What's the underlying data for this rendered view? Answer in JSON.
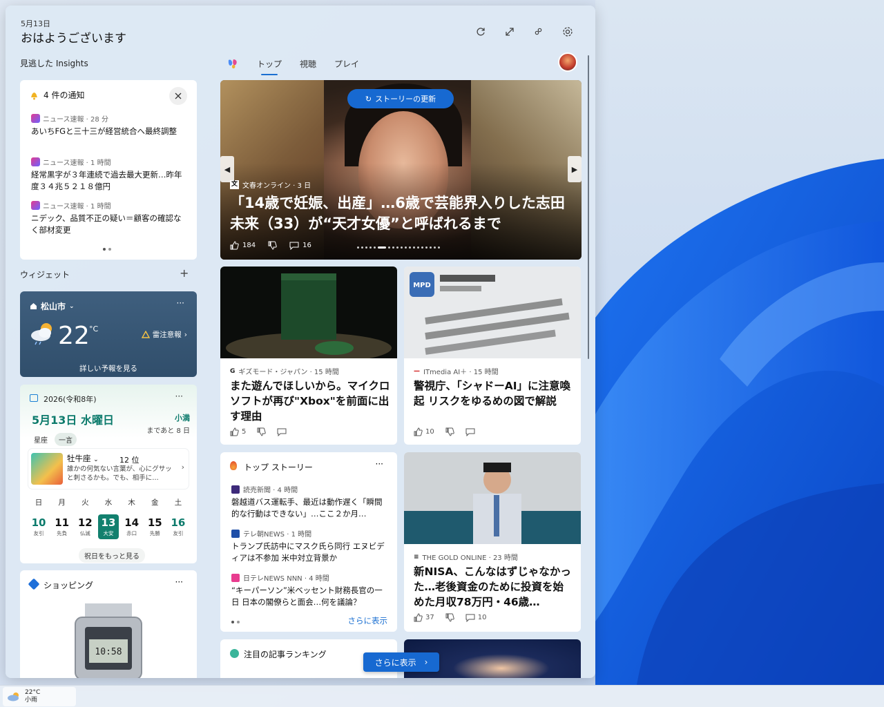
{
  "header": {
    "date": "5月13日",
    "greeting": "おはようございます"
  },
  "left": {
    "insights_title": "見逃した Insights",
    "widgets_title": "ウィジェット"
  },
  "notifications": {
    "title": "4 件の通知",
    "items": [
      {
        "source": "ニュース速報 · 28 分",
        "text": "あいちFGと三十三が経営統合へ最終調整"
      },
      {
        "source": "ニュース速報 · 1 時間",
        "text": "経常黒字が３年連続で過去最大更新…昨年度３４兆５２１８億円"
      },
      {
        "source": "ニュース速報 · 1 時間",
        "text": "ニデック、品質不正の疑い＝顧客の確認なく部材変更"
      }
    ]
  },
  "weather": {
    "location": "松山市",
    "temperature": "22",
    "unit": "°C",
    "warning": "雷注意報",
    "link": "詳しい予報を見る"
  },
  "calendar": {
    "year": "2026(令和8年)",
    "date": "5月13日 水曜日",
    "season": "小満",
    "until": "まであと 8 日",
    "tabs": [
      "星座",
      "一言"
    ],
    "horoscope": {
      "sign": "牡牛座",
      "rank": "12 位",
      "text": "誰かの何気ない言葉が、心にグサッと刺さるかも。でも、相手に…"
    },
    "days": [
      {
        "name": "日",
        "date": "10",
        "rokuyo": "友引"
      },
      {
        "name": "月",
        "date": "11",
        "rokuyo": "先負"
      },
      {
        "name": "火",
        "date": "12",
        "rokuyo": "仏滅"
      },
      {
        "name": "水",
        "date": "13",
        "rokuyo": "大安"
      },
      {
        "name": "木",
        "date": "14",
        "rokuyo": "赤口"
      },
      {
        "name": "金",
        "date": "15",
        "rokuyo": "先勝"
      },
      {
        "name": "土",
        "date": "16",
        "rokuyo": "友引"
      }
    ],
    "holidays_link": "祝日をもっと見る"
  },
  "shopping": {
    "title": "ショッピング"
  },
  "feed": {
    "tabs": [
      "トップ",
      "視聴",
      "プレイ"
    ],
    "hero": {
      "refresh": "ストーリーの更新",
      "source": "文春オンライン · 3 日",
      "headline": "「14歳で妊娠、出産」…6歳で芸能界入りした志田未来（33）が“天才女優”と呼ばれるまで",
      "likes": "184",
      "comments": "16"
    },
    "card1": {
      "source": "ギズモード・ジャパン · 15 時間",
      "title": "また遊んでほしいから。マイクロソフトが再び\"Xbox\"を前面に出す理由",
      "likes": "5"
    },
    "card2": {
      "source": "ITmedia AI＋ · 15 時間",
      "title": "警視庁、「シャドーAI」に注意喚起 リスクをゆるめの図で解説",
      "likes": "10"
    },
    "top_stories": {
      "title": "トップ ストーリー",
      "items": [
        {
          "source": "読売新聞 · 4 時間",
          "text": "磐越道バス運転手、最近は動作遅く「瞬間的な行動はできない」…ここ２か月…"
        },
        {
          "source": "テレ朝NEWS · 1 時間",
          "text": "トランプ氏訪中にマスク氏ら同行 エヌビディアは不参加 米中対立背景か"
        },
        {
          "source": "日テレNEWS NNN · 4 時間",
          "text": "“キーパーソン”米ベッセント財務長官の一日 日本の閣僚らと面会…何を議論？"
        }
      ],
      "show_more": "さらに表示"
    },
    "card3": {
      "source": "THE GOLD ONLINE · 23 時間",
      "title": "新NISA、こんなはずじゃなかった…老後資金のために投資を始めた月収78万円・46歳…",
      "likes": "37",
      "comments": "10"
    },
    "ranking": {
      "title": "注目の記事ランキング"
    },
    "show_more_button": "さらに表示"
  },
  "taskbar": {
    "temp": "22°C",
    "condition": "小雨"
  },
  "colors": {
    "accent": "#1769d1",
    "calendar_green": "#12806e"
  }
}
